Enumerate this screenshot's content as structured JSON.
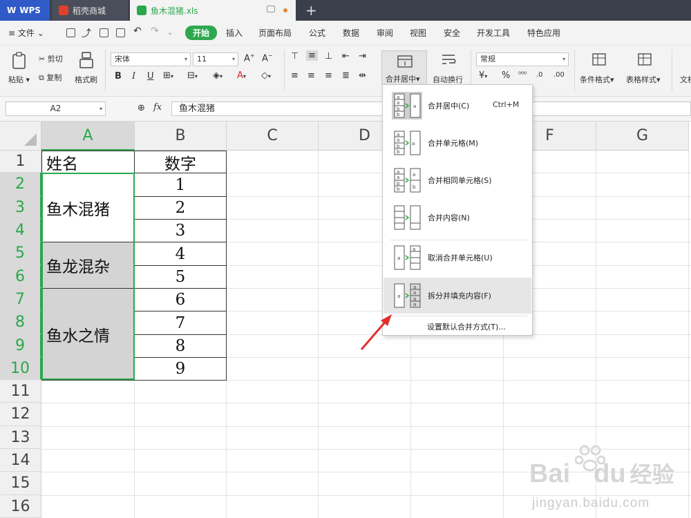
{
  "tabs": [
    {
      "label": "WPS"
    },
    {
      "label": "稻壳商城"
    },
    {
      "label": "鱼木混猪.xls"
    }
  ],
  "menu": {
    "file": "文件",
    "items": [
      "开始",
      "插入",
      "页面布局",
      "公式",
      "数据",
      "审阅",
      "视图",
      "安全",
      "开发工具",
      "特色应用"
    ]
  },
  "ribbon": {
    "paste": "粘贴",
    "cut": "剪切",
    "copy": "复制",
    "format_painter": "格式刷",
    "font_name": "宋体",
    "font_size": "11",
    "merge_center": "合并居中",
    "auto_wrap": "自动换行",
    "number_format": "常规",
    "cond_format": "条件格式",
    "table_style": "表格样式",
    "doc": "文档"
  },
  "formula_bar": {
    "name_box": "A2",
    "fx": "fx",
    "value": "鱼木混猪"
  },
  "columns": [
    "A",
    "B",
    "C",
    "D",
    "E",
    "F",
    "G"
  ],
  "rows": [
    "1",
    "2",
    "3",
    "4",
    "5",
    "6",
    "7",
    "8",
    "9",
    "10",
    "11",
    "12",
    "13",
    "14",
    "15",
    "16"
  ],
  "sheet": {
    "header_a": "姓名",
    "header_b": "数字",
    "merged_a": [
      "鱼木混猪",
      "鱼龙混杂",
      "鱼水之情"
    ],
    "col_b": [
      "1",
      "2",
      "3",
      "4",
      "5",
      "6",
      "7",
      "8",
      "9"
    ]
  },
  "dropdown": {
    "items": [
      {
        "label": "合并居中(C)",
        "shortcut": "Ctrl+M"
      },
      {
        "label": "合并单元格(M)"
      },
      {
        "label": "合并相同单元格(S)"
      },
      {
        "label": "合并内容(N)"
      },
      {
        "label": "取消合并单元格(U)"
      },
      {
        "label": "拆分并填充内容(F)"
      }
    ],
    "footer": "设置默认合并方式(T)..."
  },
  "icon_letters": {
    "a": "a",
    "b": "b"
  },
  "watermark": {
    "brand": "Bai",
    "brand2": "du",
    "cn": "经验",
    "url": "jingyan.baidu.com"
  },
  "colors": {
    "accent": "#2ea84f",
    "tabbar": "#3b3f4b",
    "arrow": "#e03030"
  }
}
